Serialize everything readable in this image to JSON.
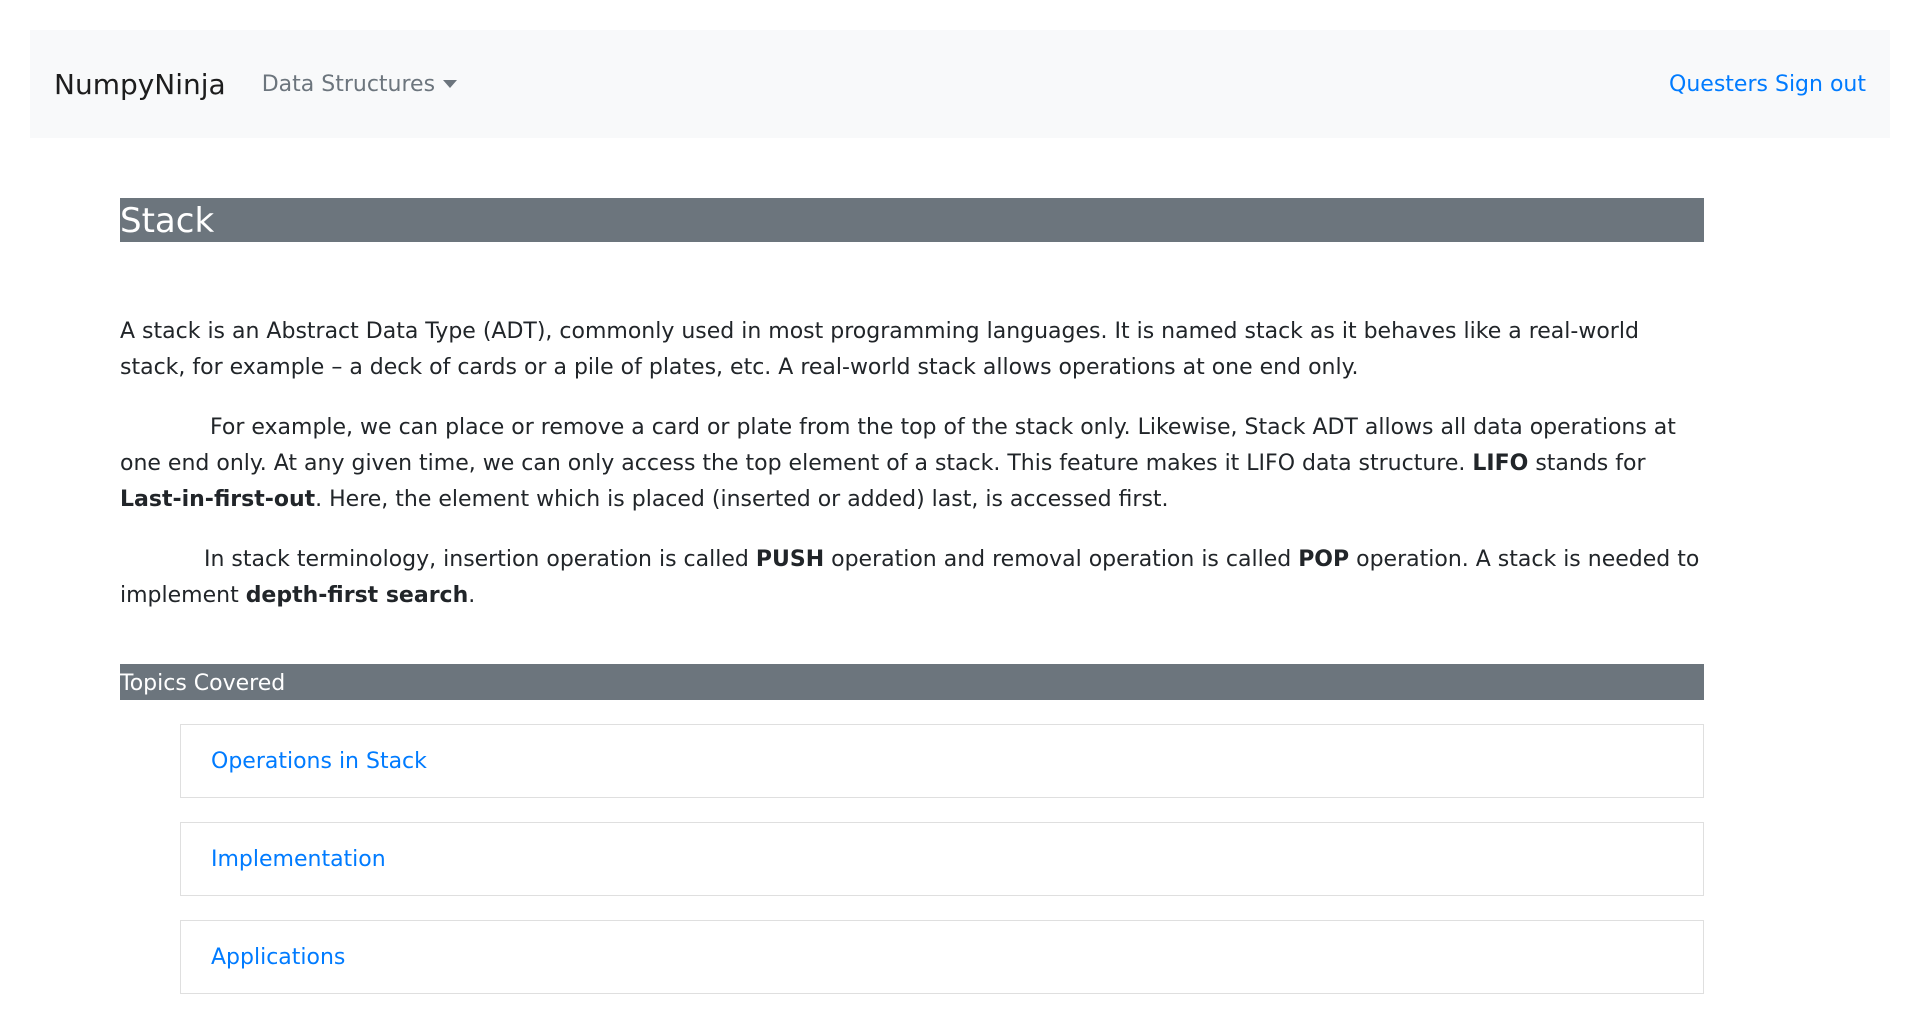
{
  "navbar": {
    "brand": "NumpyNinja",
    "dropdown_label": "Data Structures",
    "user_link": "Questers",
    "signout_link": "Sign out"
  },
  "page": {
    "title": "Stack",
    "paragraphs": [
      [
        {
          "text": "A stack is an Abstract Data Type (ADT), commonly used in most programming languages. It is named stack as it behaves like a real-world stack, for example – a deck of cards or a pile of plates, etc. A real-world stack allows operations at one end only.",
          "bold": false
        }
      ],
      [
        {
          "text": "For example, we can place or remove a card or plate from the top of the stack only. Likewise, Stack ADT allows all data operations at one end only. At any given time, we can only access the top element of a stack. This feature makes it LIFO data structure. ",
          "bold": false
        },
        {
          "text": "LIFO",
          "bold": true
        },
        {
          "text": " stands for ",
          "bold": false
        },
        {
          "text": "Last-in-first-out",
          "bold": true
        },
        {
          "text": ". Here, the element which is placed (inserted or added) last, is accessed first.",
          "bold": false
        }
      ],
      [
        {
          "text": "In stack terminology, insertion operation is called ",
          "bold": false
        },
        {
          "text": "PUSH",
          "bold": true
        },
        {
          "text": " operation and removal operation is called ",
          "bold": false
        },
        {
          "text": "POP",
          "bold": true
        },
        {
          "text": " operation. A stack is needed to implement ",
          "bold": false
        },
        {
          "text": "depth-first search",
          "bold": true
        },
        {
          "text": ".",
          "bold": false
        }
      ]
    ],
    "topics_heading": "Topics Covered",
    "topics": [
      "Operations in Stack",
      "Implementation",
      "Applications"
    ]
  },
  "colors": {
    "accent": "#007bff",
    "header_bar": "#6c757d",
    "navbar_bg": "#f8f9fa"
  }
}
